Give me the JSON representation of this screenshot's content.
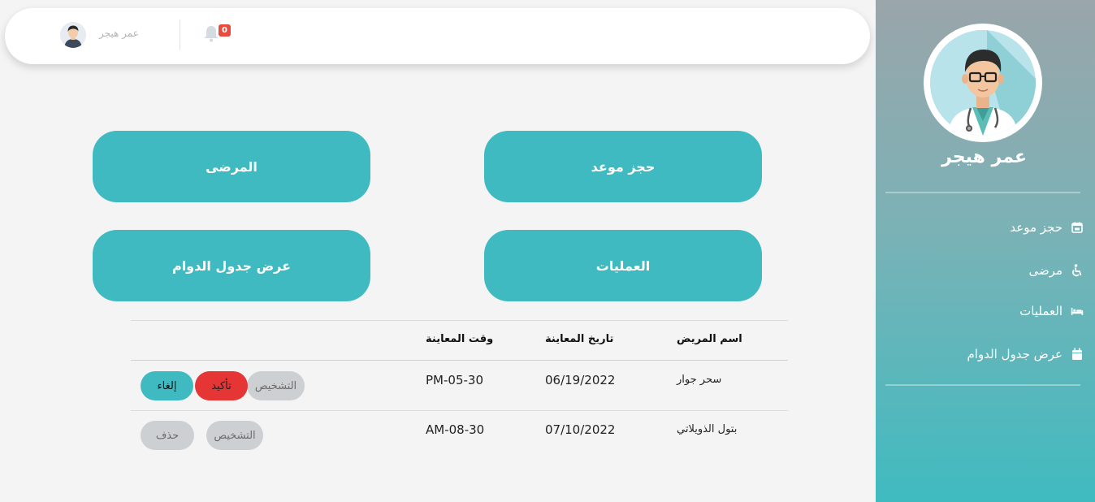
{
  "header": {
    "user_name": "عمر هيجر",
    "notification_count": "0"
  },
  "sidebar": {
    "doctor_name": "عمر هيجر",
    "items": [
      {
        "label": "حجز موعد",
        "icon": "calendar-plus-icon"
      },
      {
        "label": "مرضى",
        "icon": "wheelchair-icon"
      },
      {
        "label": "العمليات",
        "icon": "bed-icon"
      },
      {
        "label": "عرض جدول الدوام",
        "icon": "calendar-icon"
      }
    ]
  },
  "actions": {
    "book_appointment": "حجز موعد",
    "patients": "المرضى",
    "operations": "العمليات",
    "schedule": "عرض جدول الدوام"
  },
  "table": {
    "headers": {
      "patient_name": "اسم المريض",
      "date": "تاريخ المعاينة",
      "time": "وقت المعاينة"
    },
    "rows": [
      {
        "patient_name": "سحر جوار",
        "date": "06/19/2022",
        "time": "PM-05-30",
        "buttons": {
          "diagnosis": "التشخيص",
          "confirm": "تأكيد",
          "cancel": "إلغاء"
        }
      },
      {
        "patient_name": "بتول الذويلاتي",
        "date": "07/10/2022",
        "time": "AM-08-30",
        "buttons": {
          "diagnosis": "التشخيص",
          "delete": "حذف"
        }
      }
    ]
  },
  "colors": {
    "accent": "#40bac1",
    "danger": "#e53535",
    "muted_button": "#cdd0d3"
  }
}
